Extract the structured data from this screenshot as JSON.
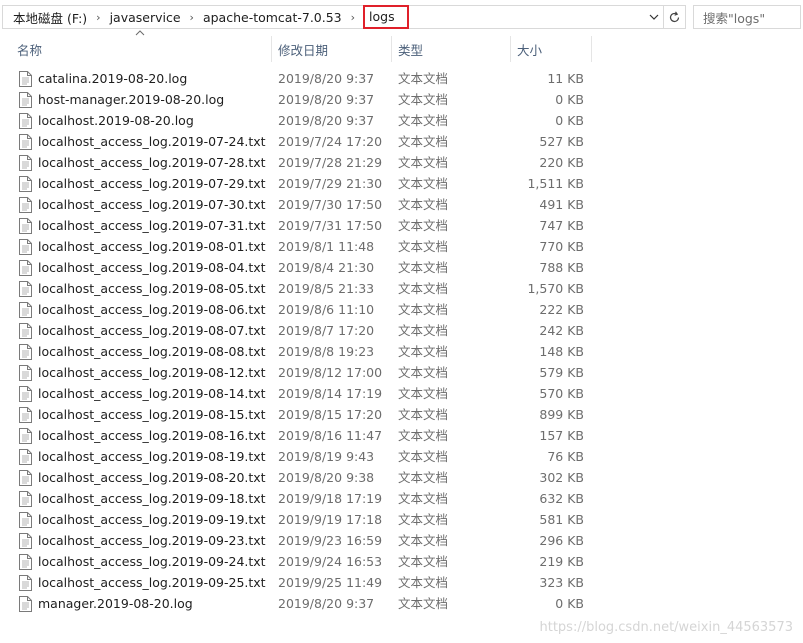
{
  "address_bar": {
    "breadcrumbs": [
      "本地磁盘 (F:)",
      "javaservice",
      "apache-tomcat-7.0.53",
      "logs"
    ],
    "dropdown_icon": "chevron-down-icon",
    "refresh_icon": "refresh-icon"
  },
  "search": {
    "placeholder": "搜索\"logs\""
  },
  "columns": {
    "name": "名称",
    "date": "修改日期",
    "type": "类型",
    "size": "大小"
  },
  "files": [
    {
      "name": "catalina.2019-08-20.log",
      "date": "2019/8/20 9:37",
      "type": "文本文档",
      "size": "11 KB"
    },
    {
      "name": "host-manager.2019-08-20.log",
      "date": "2019/8/20 9:37",
      "type": "文本文档",
      "size": "0 KB"
    },
    {
      "name": "localhost.2019-08-20.log",
      "date": "2019/8/20 9:37",
      "type": "文本文档",
      "size": "0 KB"
    },
    {
      "name": "localhost_access_log.2019-07-24.txt",
      "date": "2019/7/24 17:20",
      "type": "文本文档",
      "size": "527 KB"
    },
    {
      "name": "localhost_access_log.2019-07-28.txt",
      "date": "2019/7/28 21:29",
      "type": "文本文档",
      "size": "220 KB"
    },
    {
      "name": "localhost_access_log.2019-07-29.txt",
      "date": "2019/7/29 21:30",
      "type": "文本文档",
      "size": "1,511 KB"
    },
    {
      "name": "localhost_access_log.2019-07-30.txt",
      "date": "2019/7/30 17:50",
      "type": "文本文档",
      "size": "491 KB"
    },
    {
      "name": "localhost_access_log.2019-07-31.txt",
      "date": "2019/7/31 17:50",
      "type": "文本文档",
      "size": "747 KB"
    },
    {
      "name": "localhost_access_log.2019-08-01.txt",
      "date": "2019/8/1 11:48",
      "type": "文本文档",
      "size": "770 KB"
    },
    {
      "name": "localhost_access_log.2019-08-04.txt",
      "date": "2019/8/4 21:30",
      "type": "文本文档",
      "size": "788 KB"
    },
    {
      "name": "localhost_access_log.2019-08-05.txt",
      "date": "2019/8/5 21:33",
      "type": "文本文档",
      "size": "1,570 KB"
    },
    {
      "name": "localhost_access_log.2019-08-06.txt",
      "date": "2019/8/6 11:10",
      "type": "文本文档",
      "size": "222 KB"
    },
    {
      "name": "localhost_access_log.2019-08-07.txt",
      "date": "2019/8/7 17:20",
      "type": "文本文档",
      "size": "242 KB"
    },
    {
      "name": "localhost_access_log.2019-08-08.txt",
      "date": "2019/8/8 19:23",
      "type": "文本文档",
      "size": "148 KB"
    },
    {
      "name": "localhost_access_log.2019-08-12.txt",
      "date": "2019/8/12 17:00",
      "type": "文本文档",
      "size": "579 KB"
    },
    {
      "name": "localhost_access_log.2019-08-14.txt",
      "date": "2019/8/14 17:19",
      "type": "文本文档",
      "size": "570 KB"
    },
    {
      "name": "localhost_access_log.2019-08-15.txt",
      "date": "2019/8/15 17:20",
      "type": "文本文档",
      "size": "899 KB"
    },
    {
      "name": "localhost_access_log.2019-08-16.txt",
      "date": "2019/8/16 11:47",
      "type": "文本文档",
      "size": "157 KB"
    },
    {
      "name": "localhost_access_log.2019-08-19.txt",
      "date": "2019/8/19 9:43",
      "type": "文本文档",
      "size": "76 KB"
    },
    {
      "name": "localhost_access_log.2019-08-20.txt",
      "date": "2019/8/20 9:38",
      "type": "文本文档",
      "size": "302 KB"
    },
    {
      "name": "localhost_access_log.2019-09-18.txt",
      "date": "2019/9/18 17:19",
      "type": "文本文档",
      "size": "632 KB"
    },
    {
      "name": "localhost_access_log.2019-09-19.txt",
      "date": "2019/9/19 17:18",
      "type": "文本文档",
      "size": "581 KB"
    },
    {
      "name": "localhost_access_log.2019-09-23.txt",
      "date": "2019/9/23 16:59",
      "type": "文本文档",
      "size": "296 KB"
    },
    {
      "name": "localhost_access_log.2019-09-24.txt",
      "date": "2019/9/24 16:53",
      "type": "文本文档",
      "size": "219 KB"
    },
    {
      "name": "localhost_access_log.2019-09-25.txt",
      "date": "2019/9/25 11:49",
      "type": "文本文档",
      "size": "323 KB"
    },
    {
      "name": "manager.2019-08-20.log",
      "date": "2019/8/20 9:37",
      "type": "文本文档",
      "size": "0 KB"
    }
  ],
  "file_icon": "text-document-icon",
  "watermark": "https://blog.csdn.net/weixin_44563573",
  "colors": {
    "highlight_border": "#e0202a",
    "header_text": "#4c607a",
    "secondary_text": "#6d6d6d"
  }
}
